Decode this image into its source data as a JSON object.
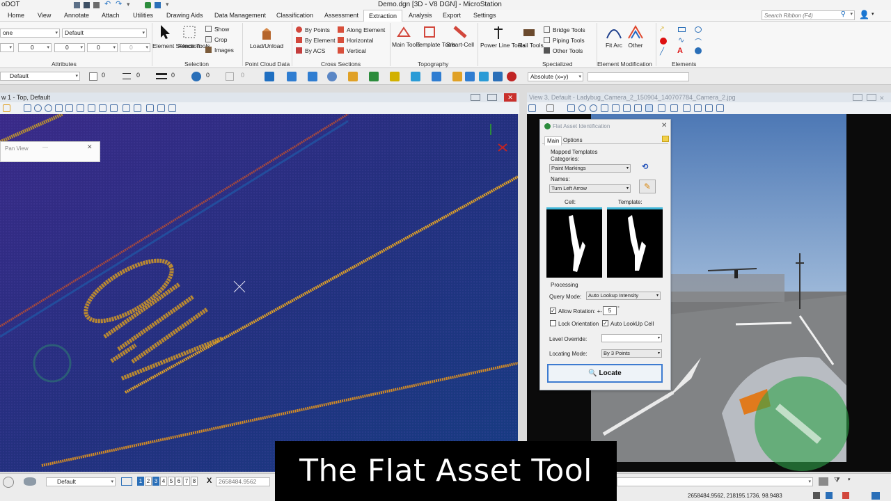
{
  "app": {
    "workspace": "oDOT",
    "title": "Demo.dgn [3D - V8 DGN] - MicroStation",
    "search_placeholder": "Search Ribbon (F4)"
  },
  "menu": [
    "Home",
    "View",
    "Annotate",
    "Attach",
    "Utilities",
    "Drawing Aids",
    "Data Management",
    "Classification",
    "Assessment",
    "Extraction",
    "Analysis",
    "Export",
    "Settings"
  ],
  "ribbon": {
    "attributes": {
      "level": "one",
      "style": "Default",
      "weight": "0",
      "color": "0",
      "line": "0",
      "label": "Attributes"
    },
    "selection": {
      "element": "Element Selection",
      "fence": "Fence Tools",
      "show": "Show",
      "crop": "Crop",
      "images": "Images",
      "label": "Selection"
    },
    "point_cloud": {
      "load": "Load/Unload",
      "label": "Point Cloud Data"
    },
    "cross_sections": {
      "by_points": "By Points",
      "by_element": "By Element",
      "by_acs": "By ACS",
      "along": "Along Element",
      "horizontal": "Horizontal",
      "vertical": "Vertical",
      "label": "Cross Sections"
    },
    "topography": {
      "main": "Main Tools",
      "template": "Template Tools",
      "smart": "Smart-Cell",
      "label": "Topography"
    },
    "specialized": {
      "power": "Power Line Tools",
      "rail": "Rail Tools",
      "bridge": "Bridge Tools",
      "piping": "Piping Tools",
      "other": "Other Tools",
      "label": "Specialized"
    },
    "element_modification": {
      "fit_arc": "Fit Arc",
      "other": "Other",
      "label": "Element Modification"
    },
    "elements": {
      "label": "Elements"
    }
  },
  "toolbar2": {
    "style": "Default",
    "v1": "0",
    "v2": "0",
    "v3": "0",
    "v4": "0",
    "v5": "0",
    "coord_mode": "Absolute (x=y)"
  },
  "view1": {
    "title": "w 1 - Top, Default"
  },
  "view3": {
    "title": "View 3, Default - Ladybug_Camera_2_150904_140707784_Camera_2.jpg"
  },
  "pan_view": {
    "title": "Pan View"
  },
  "dialog": {
    "title": "Flat Asset Identification",
    "tabs": [
      "Main",
      "Options"
    ],
    "mapped_templates": "Mapped Templates",
    "categories_label": "Categories:",
    "category_value": "Paint Markings",
    "names_label": "Names:",
    "name_value": "Turn Left Arrow",
    "cell_label": "Cell:",
    "template_label": "Template:",
    "processing": "Processing",
    "query_mode_label": "Query Mode:",
    "query_mode_value": "Auto Lookup Intensity",
    "allow_rotation": "Allow Rotation: +-",
    "rotation_value": "5",
    "rotation_unit": "°",
    "lock_orientation": "Lock Orientation",
    "auto_lookup_cell": "Auto LookUp Cell",
    "level_override_label": "Level Override:",
    "level_override_value": "",
    "locating_mode_label": "Locating Mode:",
    "locating_mode_value": "By 3 Points",
    "locate_button": "Locate",
    "allow_rotation_checked": true,
    "lock_orientation_checked": false,
    "auto_lookup_checked": true
  },
  "status": {
    "view_group": "Default",
    "views": [
      "1",
      "2",
      "3",
      "4",
      "5",
      "6",
      "7",
      "8"
    ],
    "x_label": "X",
    "x_value": "2658484.9562",
    "coords": "2658484.9562, 218195.1736, 98.9483"
  },
  "caption": "The Flat Asset Tool",
  "colors": {
    "accent": "#1f6fc1",
    "canvas_bg": "#2a2a7c",
    "paint": "#e0a126",
    "dialog_cyan": "#3fb6d8"
  }
}
